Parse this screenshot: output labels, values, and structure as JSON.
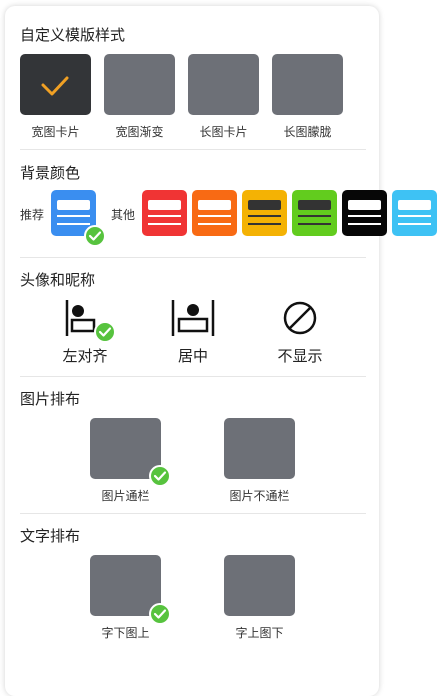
{
  "template": {
    "title": "自定义模版样式",
    "options": [
      {
        "label": "宽图卡片",
        "selected": true,
        "checkmark_color": "#f0a024"
      },
      {
        "label": "宽图渐变",
        "selected": false
      },
      {
        "label": "长图卡片",
        "selected": false
      },
      {
        "label": "长图朦胧",
        "selected": false
      }
    ]
  },
  "background": {
    "title": "背景颜色",
    "recommended_label": "推荐",
    "other_label": "其他",
    "recommended_color": "#3a8ef0",
    "other_colors": [
      "#f03434",
      "#f86a14",
      "#f4b204",
      "#62cc1e",
      "#070707",
      "#3ec2f4"
    ]
  },
  "avatar": {
    "title": "头像和昵称",
    "options": [
      {
        "label": "左对齐",
        "selected": true
      },
      {
        "label": "居中",
        "selected": false
      },
      {
        "label": "不显示",
        "selected": false
      }
    ]
  },
  "image_layout": {
    "title": "图片排布",
    "options": [
      {
        "label": "图片通栏",
        "selected": true
      },
      {
        "label": "图片不通栏",
        "selected": false
      }
    ]
  },
  "text_layout": {
    "title": "文字排布",
    "options": [
      {
        "label": "字下图上",
        "selected": true
      },
      {
        "label": "字上图下",
        "selected": false
      }
    ]
  },
  "colors": {
    "check": "#57c33e",
    "tile": "#6d7077",
    "tile_selected": "#333538"
  }
}
